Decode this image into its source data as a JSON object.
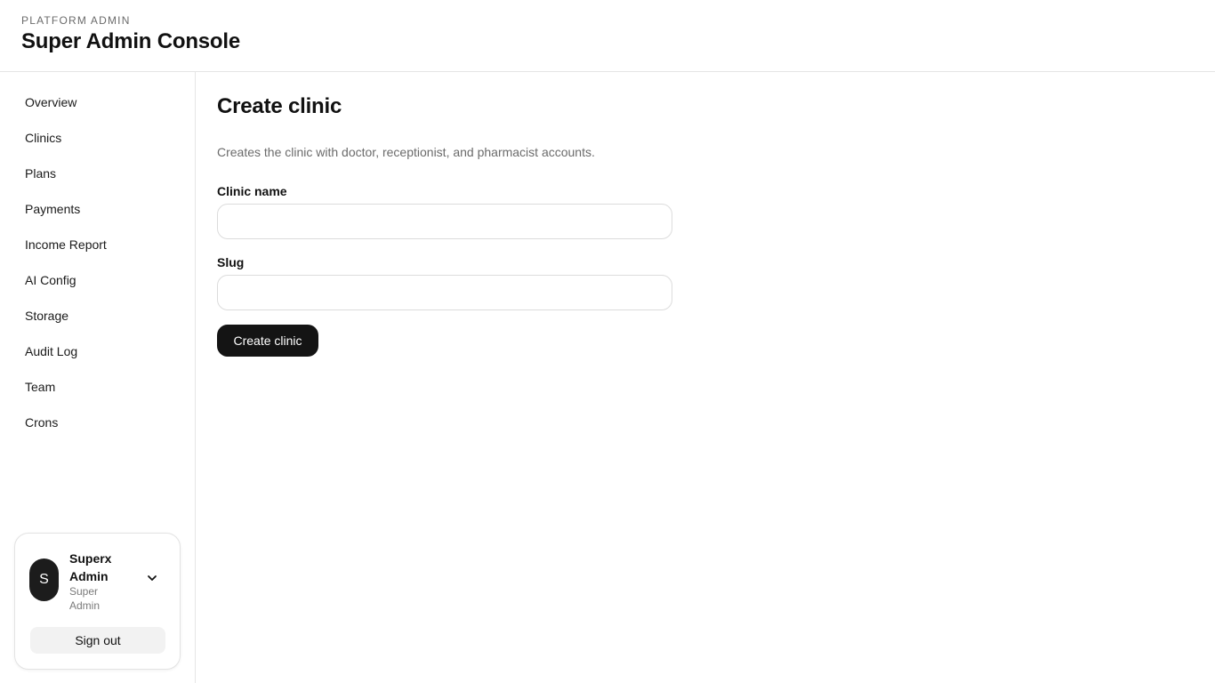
{
  "header": {
    "eyebrow": "PLATFORM ADMIN",
    "title": "Super Admin Console"
  },
  "sidebar": {
    "items": [
      {
        "label": "Overview"
      },
      {
        "label": "Clinics"
      },
      {
        "label": "Plans"
      },
      {
        "label": "Payments"
      },
      {
        "label": "Income Report"
      },
      {
        "label": "AI Config"
      },
      {
        "label": "Storage"
      },
      {
        "label": "Audit Log"
      },
      {
        "label": "Team"
      },
      {
        "label": "Crons"
      }
    ],
    "user": {
      "initial": "S",
      "name": "Superx Admin",
      "role": "Super Admin",
      "menu_icon": "chevron-down-icon",
      "sign_out_label": "Sign out"
    }
  },
  "main": {
    "title": "Create clinic",
    "description": "Creates the clinic with doctor, receptionist, and pharmacist accounts.",
    "fields": [
      {
        "label": "Clinic name",
        "value": "",
        "placeholder": ""
      },
      {
        "label": "Slug",
        "value": "",
        "placeholder": ""
      }
    ],
    "submit_label": "Create clinic"
  },
  "colors": {
    "primary_button": "#141414",
    "avatar": "#1c1c1c",
    "border": "#e5e5e5",
    "muted_text": "#6b6b6b"
  }
}
